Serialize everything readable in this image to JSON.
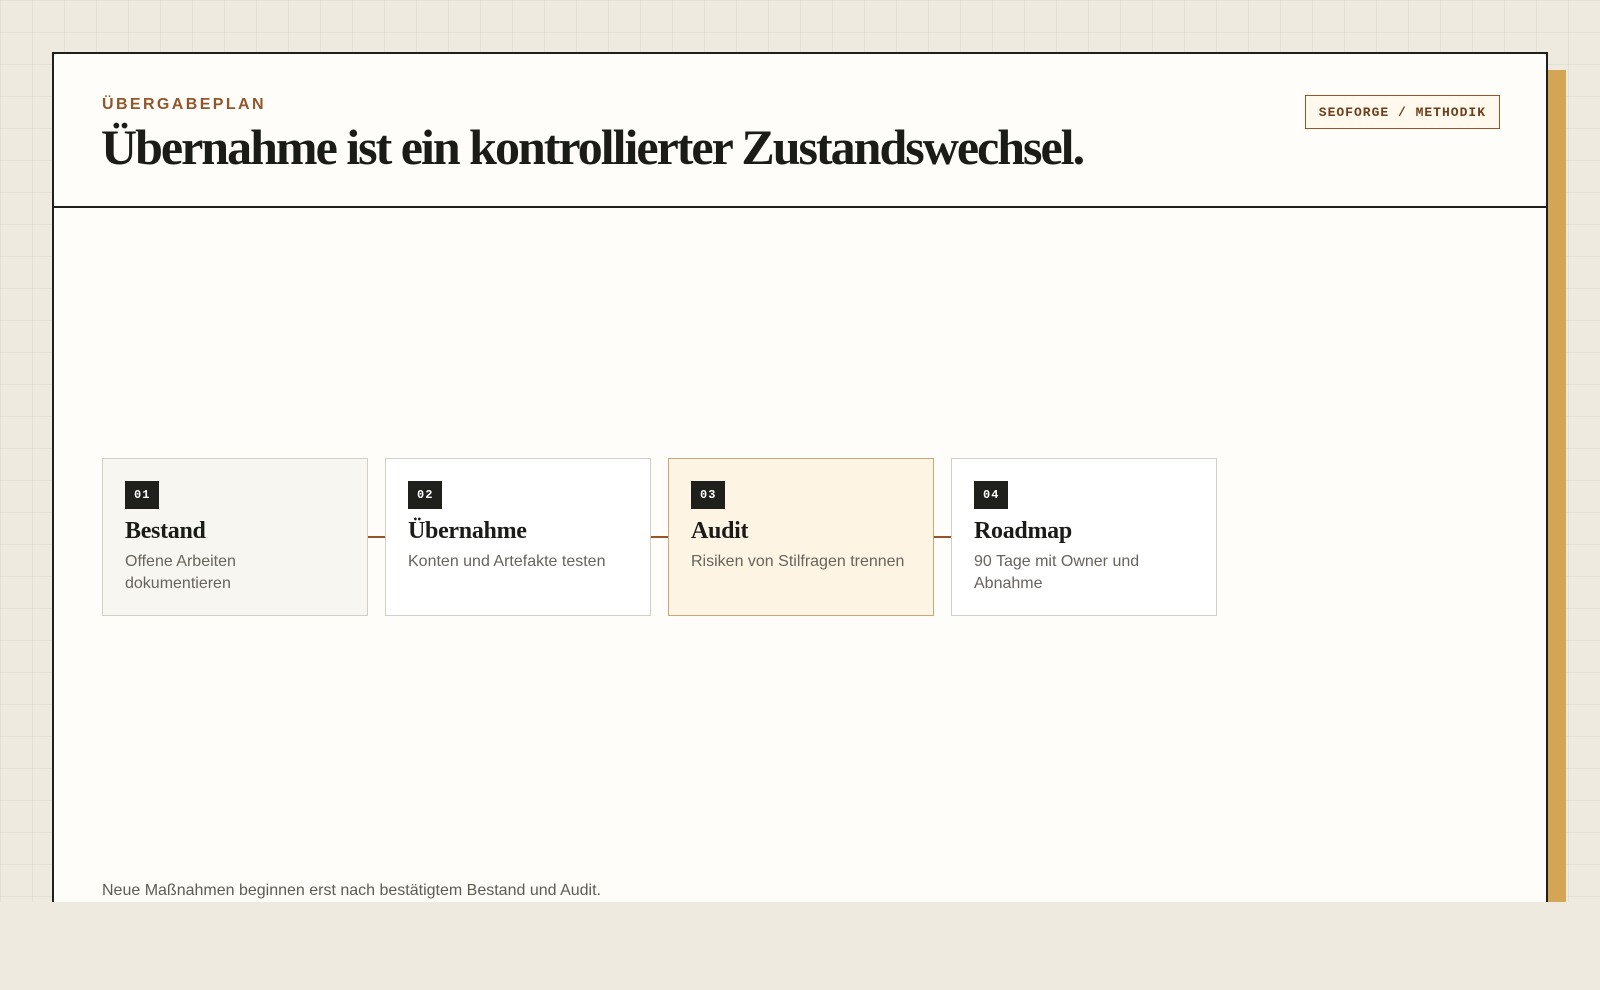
{
  "header": {
    "kicker": "ÜBERGABEPLAN",
    "title": "Übernahme ist ein kontrollierter Zustandswechsel.",
    "tag": "SEOFORGE / METHODIK"
  },
  "steps": [
    {
      "number": "01",
      "title": "Bestand",
      "description": "Offene Arbeiten dokumentieren",
      "state": "done"
    },
    {
      "number": "02",
      "title": "Übernahme",
      "description": "Konten und Artefakte testen",
      "state": "default"
    },
    {
      "number": "03",
      "title": "Audit",
      "description": "Risiken von Stilfragen trennen",
      "state": "active"
    },
    {
      "number": "04",
      "title": "Roadmap",
      "description": "90 Tage mit Owner und Abnahme",
      "state": "default"
    }
  ],
  "footer": {
    "note": "Neue Maßnahmen beginnen erst nach bestätigtem Bestand und Audit."
  },
  "colors": {
    "accent": "#93552a",
    "shadow": "#d4a654",
    "active_step_background": "#fef4e4",
    "ink": "#1f1f1b"
  }
}
